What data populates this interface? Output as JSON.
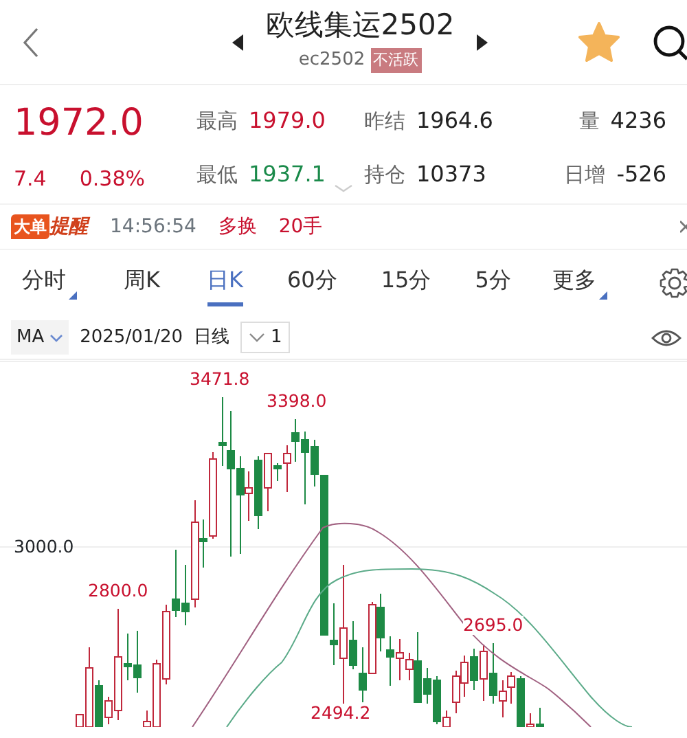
{
  "header": {
    "title": "欧线集运2502",
    "code": "ec2502",
    "status_badge": "不活跃"
  },
  "quote": {
    "price": "1972.0",
    "change": "7.4",
    "change_pct": "0.38%",
    "color": "#c8102e",
    "stats": [
      {
        "label": "最高",
        "value": "1979.0",
        "color": "#c8102e"
      },
      {
        "label": "昨结",
        "value": "1964.6",
        "color": "#222222"
      },
      {
        "label": "量",
        "value": "4236",
        "color": "#222222"
      },
      {
        "label": "最低",
        "value": "1937.1",
        "color": "#1a8a4a"
      },
      {
        "label": "持仓",
        "value": "10373",
        "color": "#222222"
      },
      {
        "label": "日增",
        "value": "-526",
        "color": "#222222"
      }
    ]
  },
  "alert": {
    "tag": "大单",
    "label": "提醒",
    "time": "14:56:54",
    "action": "多换",
    "size": "20手"
  },
  "tabs": [
    {
      "label": "分时",
      "selected": false,
      "dropdown": true
    },
    {
      "label": "周K",
      "selected": false,
      "dropdown": false
    },
    {
      "label": "日K",
      "selected": true,
      "dropdown": false
    },
    {
      "label": "60分",
      "selected": false,
      "dropdown": false
    },
    {
      "label": "15分",
      "selected": false,
      "dropdown": false
    },
    {
      "label": "5分",
      "selected": false,
      "dropdown": false
    },
    {
      "label": "更多",
      "selected": false,
      "dropdown": true
    }
  ],
  "indicator_bar": {
    "indicator": "MA",
    "date": "2025/01/20",
    "period": "日线",
    "adjust": "1"
  },
  "chart": {
    "axis_label": "3000.0",
    "annotations": [
      "3471.8",
      "3398.0",
      "2800.0",
      "2695.0",
      "2494.2"
    ]
  }
}
